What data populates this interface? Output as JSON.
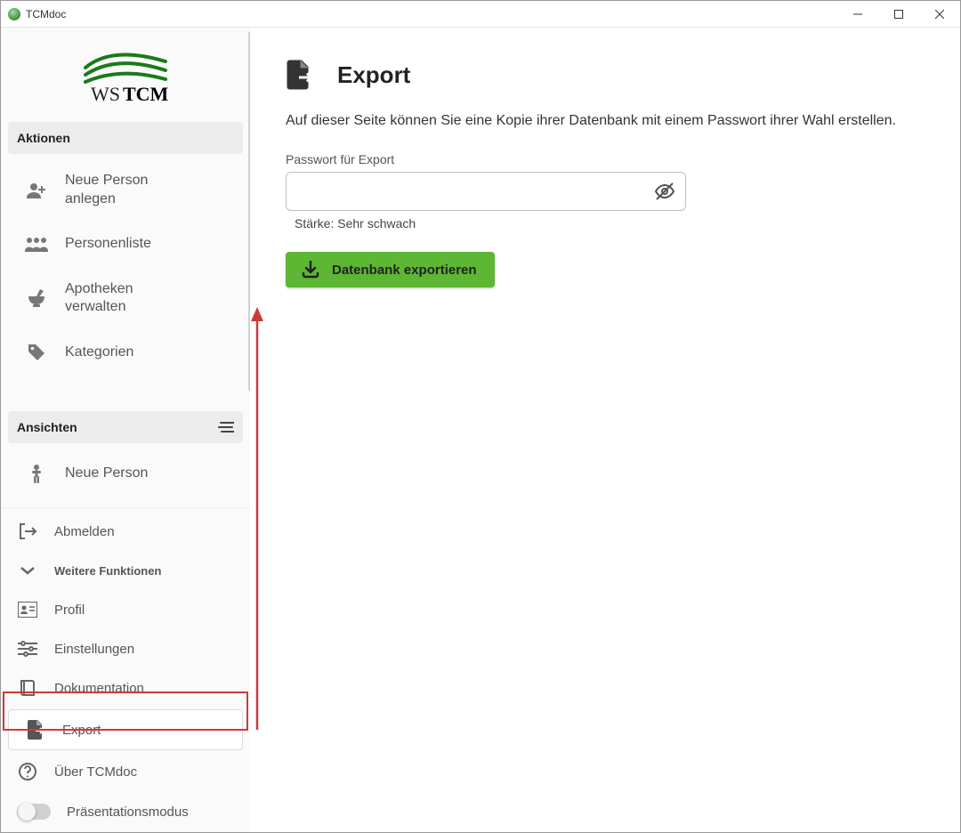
{
  "window": {
    "title": "TCMdoc"
  },
  "logo": {
    "text_ws": "WS",
    "text_tcm": "TCM"
  },
  "sections": {
    "aktionen": "Aktionen",
    "ansichten": "Ansichten"
  },
  "nav_aktionen": [
    {
      "label": "Neue Person anlegen"
    },
    {
      "label": "Personenliste"
    },
    {
      "label": "Apotheken verwalten"
    },
    {
      "label": "Kategorien"
    }
  ],
  "nav_ansichten": [
    {
      "label": "Neue Person"
    }
  ],
  "bottom_nav": {
    "abmelden": "Abmelden",
    "weitere": "Weitere Funktionen",
    "profil": "Profil",
    "einstellungen": "Einstellungen",
    "dokumentation": "Dokumentation",
    "export": "Export",
    "ueber": "Über TCMdoc",
    "praesentation": "Präsentationsmodus"
  },
  "main": {
    "title": "Export",
    "description": "Auf dieser Seite können Sie eine Kopie ihrer Datenbank mit einem Passwort ihrer Wahl erstellen.",
    "password_label": "Passwort für Export",
    "strength_label": "Stärke: Sehr schwach",
    "export_button": "Datenbank exportieren"
  }
}
